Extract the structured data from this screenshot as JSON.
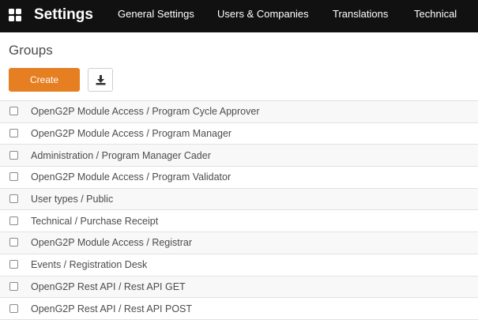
{
  "navbar": {
    "brand": "Settings",
    "menu": [
      {
        "label": "General Settings"
      },
      {
        "label": "Users & Companies"
      },
      {
        "label": "Translations"
      },
      {
        "label": "Technical"
      }
    ]
  },
  "page": {
    "title": "Groups",
    "create_label": "Create"
  },
  "groups": [
    "OpenG2P Module Access / Program Cycle Approver",
    "OpenG2P Module Access / Program Manager",
    "Administration / Program Manager Cader",
    "OpenG2P Module Access / Program Validator",
    "User types / Public",
    "Technical / Purchase Receipt",
    "OpenG2P Module Access / Registrar",
    "Events / Registration Desk",
    "OpenG2P Rest API / Rest API GET",
    "OpenG2P Rest API / Rest API POST"
  ],
  "colors": {
    "navbar": "#111111",
    "accent": "#e67e22"
  }
}
